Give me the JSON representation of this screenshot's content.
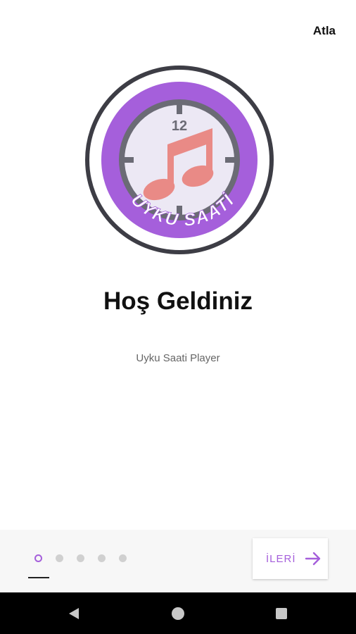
{
  "header": {
    "skip_label": "Atla"
  },
  "logo": {
    "icon": "sleep-timer-clock-music-logo",
    "clock_number": "12",
    "text": "UYKU SAATİ",
    "colors": {
      "ring": "#3d3d45",
      "band": "#a55fdb",
      "face": "#ece8f4",
      "note": "#e98a86",
      "hands": "#6b6b75"
    }
  },
  "welcome": {
    "title": "Hoş Geldiniz",
    "subtitle": "Uyku Saati Player"
  },
  "pager": {
    "pages": 5,
    "active_page": 1
  },
  "next_button": {
    "label": "İLERİ",
    "icon": "arrow-right-icon"
  },
  "system_nav": {
    "back_icon": "back-triangle-icon",
    "home_icon": "home-circle-icon",
    "recents_icon": "recents-square-icon"
  },
  "colors": {
    "accent": "#a55fdb",
    "text": "#111111",
    "subtitle": "#666666",
    "bottom_bar": "#f7f7f7"
  }
}
